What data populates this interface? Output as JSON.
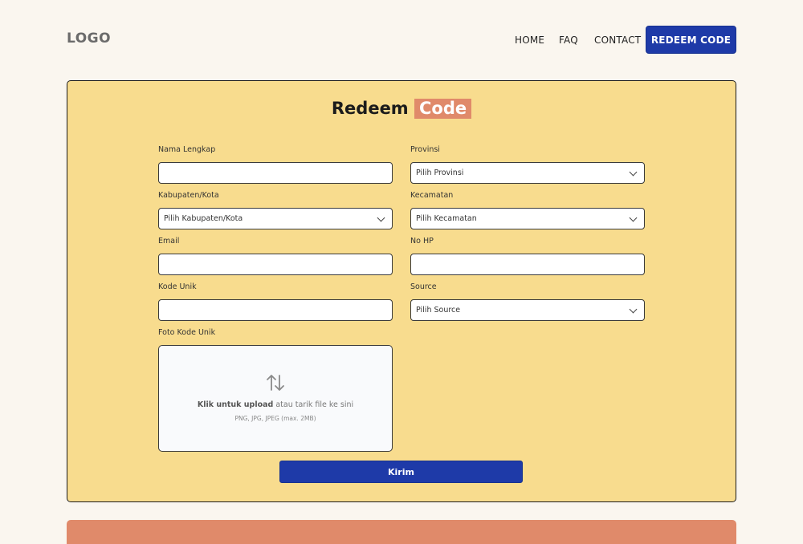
{
  "header": {
    "logo": "LOGO",
    "nav": {
      "home": "HOME",
      "faq": "FAQ",
      "contact": "CONTACT"
    },
    "cta": "REDEEM CODE"
  },
  "form": {
    "title_main": "Redeem",
    "title_highlight": "Code",
    "fields": {
      "nama_lengkap": {
        "label": "Nama Lengkap",
        "value": ""
      },
      "provinsi": {
        "label": "Provinsi",
        "value": "Pilih Provinsi"
      },
      "kabupaten": {
        "label": "Kabupaten/Kota",
        "value": "Pilih Kabupaten/Kota"
      },
      "kecamatan": {
        "label": "Kecamatan",
        "value": "Pilih Kecamatan"
      },
      "email": {
        "label": "Email",
        "value": ""
      },
      "no_hp": {
        "label": "No HP",
        "value": ""
      },
      "kode_unik": {
        "label": "Kode Unik",
        "value": ""
      },
      "source": {
        "label": "Source",
        "value": "Pilih Source"
      }
    },
    "upload": {
      "label": "Foto Kode Unik",
      "action_strong": "Klik untuk upload",
      "action_rest": " atau tarik file ke sini",
      "hint": "PNG, JPG, JPEG (max. 2MB)"
    },
    "submit": "Kirim"
  },
  "colors": {
    "background": "#faf6ef",
    "card": "#f8dc8e",
    "primary": "#1e3aa8",
    "accent": "#e08a6a"
  },
  "icons": {
    "upload": "arrows-up-down-icon",
    "select": "chevron-down-icon"
  }
}
